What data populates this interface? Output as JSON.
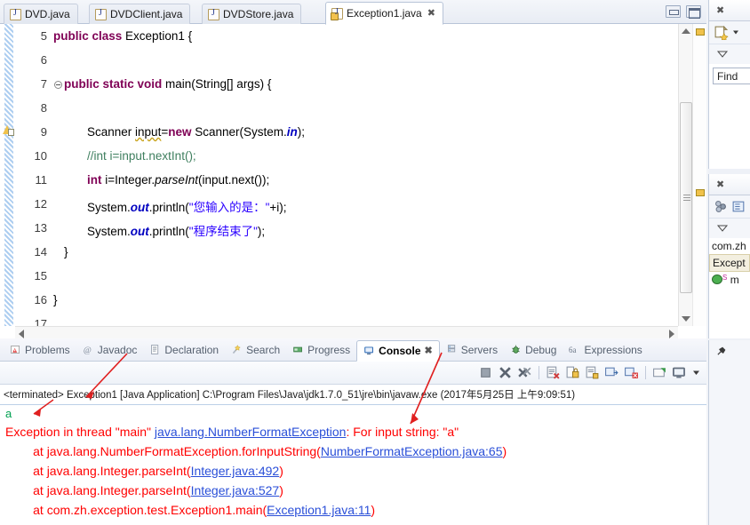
{
  "editor": {
    "tabs": [
      {
        "label": "DVD.java",
        "active": false,
        "warning": false
      },
      {
        "label": "DVDClient.java",
        "active": false,
        "warning": false
      },
      {
        "label": "DVDStore.java",
        "active": false,
        "warning": false
      },
      {
        "label": "Exception1.java",
        "active": true,
        "warning": true
      }
    ],
    "close_glyph": "✖",
    "window_buttons": {
      "minimize": "minimize-button",
      "maximize": "maximize-button"
    },
    "lines": [
      {
        "num": "5",
        "fold": false,
        "marker": false
      },
      {
        "num": "6",
        "fold": false,
        "marker": false
      },
      {
        "num": "7",
        "fold": true,
        "marker": false
      },
      {
        "num": "8",
        "fold": false,
        "marker": false
      },
      {
        "num": "9",
        "fold": false,
        "marker": true
      },
      {
        "num": "10",
        "fold": false,
        "marker": false
      },
      {
        "num": "11",
        "fold": false,
        "marker": false
      },
      {
        "num": "12",
        "fold": false,
        "marker": false
      },
      {
        "num": "13",
        "fold": false,
        "marker": false
      },
      {
        "num": "14",
        "fold": false,
        "marker": false
      },
      {
        "num": "15",
        "fold": false,
        "marker": false
      },
      {
        "num": "16",
        "fold": false,
        "marker": false
      },
      {
        "num": "17",
        "fold": false,
        "marker": false
      }
    ],
    "code": {
      "l5_kw": "public class",
      "l5_rest": " Exception1 {",
      "l7_kw": "public static void",
      "l7_rest": " main(String[] args) {",
      "l9_a": "Scanner ",
      "l9_var": "input",
      "l9_b": "=",
      "l9_kw": "new",
      "l9_c": " Scanner(System.",
      "l9_fld": "in",
      "l9_d": ");",
      "l10_comment": "//int i=input.nextInt();",
      "l11_kw": "int",
      "l11_a": " i=Integer.",
      "l11_mth": "parseInt",
      "l11_b": "(input.next());",
      "l12_a": "System.",
      "l12_fld": "out",
      "l12_b": ".println(",
      "l12_str": "\"您输入的是：\"",
      "l12_c": "+i);",
      "l13_a": "System.",
      "l13_fld": "out",
      "l13_b": ".println(",
      "l13_str": "\"程序结束了\"",
      "l13_c": ");",
      "l14": "}",
      "l16": "}"
    }
  },
  "right_panels": {
    "search_panel": {
      "tab_close": "✖",
      "new_search_icon": "new-search-icon",
      "dropdown_icon": "chevron-down-icon",
      "menu_icon": "view-menu-icon",
      "find_label": "Find"
    },
    "outline_panel": {
      "tab_close": "✖",
      "sort_icon": "sort-icon",
      "filter_icon": "filter-icon",
      "menu_icon": "view-menu-icon",
      "rows": [
        {
          "text": "com.zh",
          "icon": "package-icon",
          "selected": false
        },
        {
          "text": "Except",
          "icon": "class-icon",
          "selected": true
        },
        {
          "text": "m",
          "icon": "method-icon",
          "selected": false
        }
      ],
      "method_badge": "S"
    }
  },
  "bottom_panel": {
    "tabs": [
      {
        "label": "Problems",
        "icon": "problems-icon",
        "active": false,
        "closeable": false
      },
      {
        "label": "Javadoc",
        "icon": "javadoc-icon",
        "active": false,
        "closeable": false
      },
      {
        "label": "Declaration",
        "icon": "declaration-icon",
        "active": false,
        "closeable": false
      },
      {
        "label": "Search",
        "icon": "search-icon",
        "active": false,
        "closeable": false
      },
      {
        "label": "Progress",
        "icon": "progress-icon",
        "active": false,
        "closeable": false
      },
      {
        "label": "Console",
        "icon": "console-icon",
        "active": true,
        "closeable": true
      },
      {
        "label": "Servers",
        "icon": "servers-icon",
        "active": false,
        "closeable": false
      },
      {
        "label": "Debug",
        "icon": "debug-icon",
        "active": false,
        "closeable": false
      },
      {
        "label": "Expressions",
        "icon": "expressions-icon",
        "active": false,
        "closeable": false
      }
    ],
    "tab_close_glyph": "✖",
    "toolbar_icons": [
      "terminate-icon",
      "remove-launch-icon",
      "remove-all-terminated-icon",
      "clear-console-icon",
      "scroll-lock-icon",
      "pin-console-icon",
      "display-selected-console-icon",
      "close-console-icon",
      "open-console-icon",
      "new-console-view-icon",
      "view-menu-icon"
    ],
    "terminated_line": "<terminated> Exception1 [Java Application] C:\\Program Files\\Java\\jdk1.7.0_51\\jre\\bin\\javaw.exe (2017年5月25日 上午9:09:51)",
    "console_output": [
      {
        "kind": "input",
        "text": "a"
      },
      {
        "kind": "error",
        "segments": [
          {
            "t": "Exception in thread \"main\" ",
            "link": false
          },
          {
            "t": "java.lang.NumberFormatException",
            "link": true
          },
          {
            "t": ": For input string: \"a\"",
            "link": false
          }
        ]
      },
      {
        "kind": "error",
        "segments": [
          {
            "t": "\tat java.lang.NumberFormatException.forInputString(",
            "link": false
          },
          {
            "t": "NumberFormatException.java:65",
            "link": true
          },
          {
            "t": ")",
            "link": false
          }
        ]
      },
      {
        "kind": "error",
        "segments": [
          {
            "t": "\tat java.lang.Integer.parseInt(",
            "link": false
          },
          {
            "t": "Integer.java:492",
            "link": true
          },
          {
            "t": ")",
            "link": false
          }
        ]
      },
      {
        "kind": "error",
        "segments": [
          {
            "t": "\tat java.lang.Integer.parseInt(",
            "link": false
          },
          {
            "t": "Integer.java:527",
            "link": true
          },
          {
            "t": ")",
            "link": false
          }
        ]
      },
      {
        "kind": "error",
        "segments": [
          {
            "t": "\tat com.zh.exception.test.Exception1.main(",
            "link": false
          },
          {
            "t": "Exception1.java:11",
            "link": true
          },
          {
            "t": ")",
            "link": false
          }
        ]
      }
    ]
  },
  "annotations": {
    "arrow_color": "#e02020",
    "arrows": [
      {
        "name": "arrow-to-terminated-line"
      },
      {
        "name": "arrow-to-exception-line"
      }
    ]
  }
}
